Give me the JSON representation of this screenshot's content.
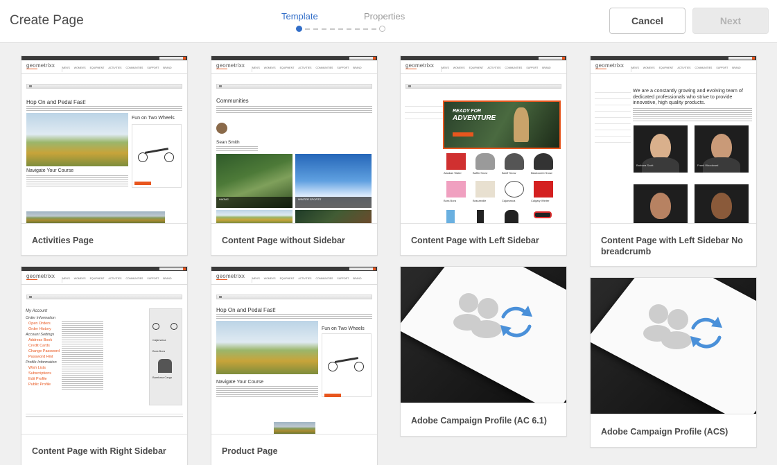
{
  "header": {
    "title": "Create Page",
    "steps": [
      "Template",
      "Properties"
    ],
    "cancel_label": "Cancel",
    "next_label": "Next"
  },
  "templates": [
    {
      "label": "Activities Page"
    },
    {
      "label": "Content Page without Sidebar"
    },
    {
      "label": "Content Page with Left Sidebar"
    },
    {
      "label": "Content Page with Left Sidebar No breadcrumb"
    },
    {
      "label": "Content Page with Right Sidebar"
    },
    {
      "label": "Product Page"
    },
    {
      "label": "Adobe Campaign Profile (AC 6.1)"
    },
    {
      "label": "Adobe Campaign Profile (ACS)"
    }
  ],
  "thumbs": {
    "brand": "geometrixx",
    "nav": [
      "MEN'S",
      "WOMEN'S",
      "EQUIPMENT",
      "ACTIVITIES",
      "COMMUNITIES",
      "SUPPORT",
      "BRAND"
    ],
    "activities": {
      "headline": "Hop On and Pedal Fast!",
      "sub1": "Fun on Two Wheels",
      "sub2": "Navigate Your Course"
    },
    "communities": {
      "headline": "Communities",
      "person": "Sean Smith",
      "caption1": "HIKING",
      "caption2": "WINTER SPORTS"
    },
    "left_sidebar": {
      "promo_small": "READY FOR",
      "promo_big": "ADVENTURE",
      "products": [
        "Alaskan Water",
        "Baffin Snow",
        "Banff Snow",
        "Blackcomb Snow",
        "Bora Bora",
        "Brazzaville",
        "Cajamarca",
        "Calgary Winter"
      ]
    },
    "no_breadcrumb": {
      "headline": "We are a constantly growing and evolving team of dedicated professionals who strive to provide innovative, high quality products.",
      "names": [
        "Barbara Scott",
        "Frank Woodward"
      ]
    },
    "right_sidebar": {
      "headline": "My Account",
      "sections": [
        {
          "title": "Order Information",
          "links": [
            "Open Orders",
            "Order History"
          ]
        },
        {
          "title": "Account Settings",
          "links": [
            "Address Book",
            "Credit Cards",
            "Change Password",
            "Password Hint"
          ]
        },
        {
          "title": "Profile Information",
          "links": [
            "Wish Lists",
            "Subscriptions",
            "Edit Profile",
            "Public Profile"
          ]
        }
      ],
      "side_items": [
        "Cajamarca",
        "Bora Bora",
        "Bambara Cargo"
      ]
    },
    "product": {
      "headline": "Hop On and Pedal Fast!",
      "sub1": "Fun on Two Wheels",
      "sub2": "Navigate Your Course"
    }
  },
  "colors": {
    "accent_blue": "#326ec8",
    "brand_orange": "#e8561e",
    "sync_blue": "#4a90d9"
  }
}
